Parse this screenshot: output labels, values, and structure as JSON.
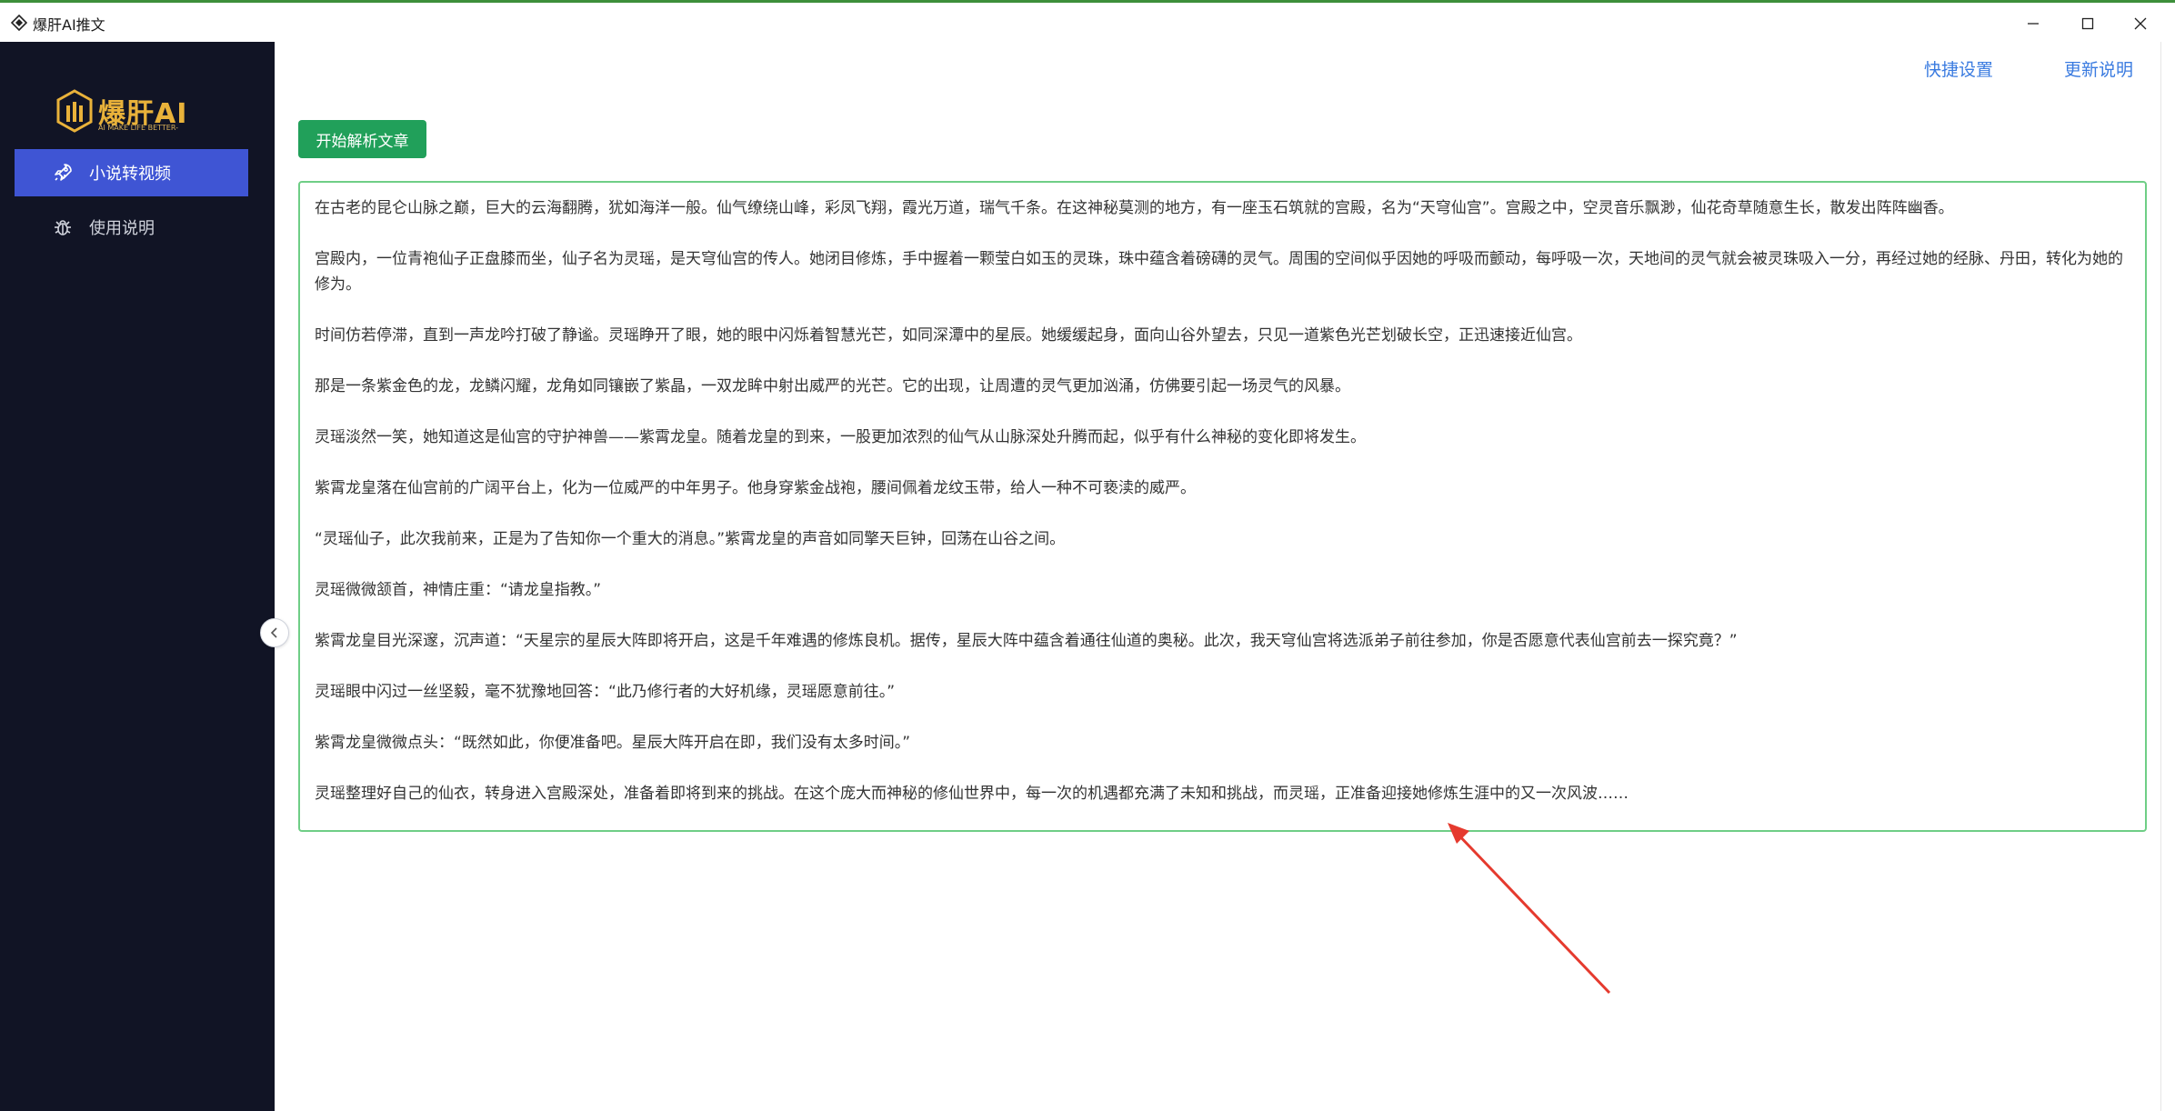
{
  "window": {
    "title": "爆肝AI推文",
    "controls": [
      "minimize-icon",
      "maximize-icon",
      "close-icon"
    ]
  },
  "sidebar": {
    "logo_text": "爆肝AI",
    "logo_subtitle": "AI MAKE LIFE BETTER-",
    "items": [
      {
        "label": "小说转视频",
        "icon": "rocket-icon",
        "active": true
      },
      {
        "label": "使用说明",
        "icon": "bug-icon",
        "active": false
      }
    ]
  },
  "header": {
    "shortcut_settings": "快捷设置",
    "update_notes": "更新说明"
  },
  "main": {
    "start_button": "开始解析文章",
    "paragraphs": [
      "在古老的昆仑山脉之巅，巨大的云海翻腾，犹如海洋一般。仙气缭绕山峰，彩凤飞翔，霞光万道，瑞气千条。在这神秘莫测的地方，有一座玉石筑就的宫殿，名为“天穹仙宫”。宫殿之中，空灵音乐飘渺，仙花奇草随意生长，散发出阵阵幽香。",
      "宫殿内，一位青袍仙子正盘膝而坐，仙子名为灵瑶，是天穹仙宫的传人。她闭目修炼，手中握着一颗莹白如玉的灵珠，珠中蕴含着磅礴的灵气。周围的空间似乎因她的呼吸而颤动，每呼吸一次，天地间的灵气就会被灵珠吸入一分，再经过她的经脉、丹田，转化为她的修为。",
      "时间仿若停滞，直到一声龙吟打破了静谧。灵瑶睁开了眼，她的眼中闪烁着智慧光芒，如同深潭中的星辰。她缓缓起身，面向山谷外望去，只见一道紫色光芒划破长空，正迅速接近仙宫。",
      "那是一条紫金色的龙，龙鳞闪耀，龙角如同镶嵌了紫晶，一双龙眸中射出威严的光芒。它的出现，让周遭的灵气更加汹涌，仿佛要引起一场灵气的风暴。",
      "灵瑶淡然一笑，她知道这是仙宫的守护神兽——紫霄龙皇。随着龙皇的到来，一股更加浓烈的仙气从山脉深处升腾而起，似乎有什么神秘的变化即将发生。",
      "紫霄龙皇落在仙宫前的广阔平台上，化为一位威严的中年男子。他身穿紫金战袍，腰间佩着龙纹玉带，给人一种不可亵渎的威严。",
      "“灵瑶仙子，此次我前来，正是为了告知你一个重大的消息。”紫霄龙皇的声音如同擎天巨钟，回荡在山谷之间。",
      "灵瑶微微颔首，神情庄重：“请龙皇指教。”",
      "紫霄龙皇目光深邃，沉声道：“天星宗的星辰大阵即将开启，这是千年难遇的修炼良机。据传，星辰大阵中蕴含着通往仙道的奥秘。此次，我天穹仙宫将选派弟子前往参加，你是否愿意代表仙宫前去一探究竟？”",
      "灵瑶眼中闪过一丝坚毅，毫不犹豫地回答：“此乃修行者的大好机缘，灵瑶愿意前往。”",
      "紫霄龙皇微微点头：“既然如此，你便准备吧。星辰大阵开启在即，我们没有太多时间。”",
      "灵瑶整理好自己的仙衣，转身进入宫殿深处，准备着即将到来的挑战。在这个庞大而神秘的修仙世界中，每一次的机遇都充满了未知和挑战，而灵瑶，正准备迎接她修炼生涯中的又一次风波……"
    ]
  },
  "annotation": {
    "arrow_color": "#e53a2e"
  },
  "colors": {
    "sidebar_bg": "#111425",
    "active_nav": "#3f55d4",
    "primary_button": "#21a05a",
    "textarea_border": "#6fce86",
    "link": "#3a7be0",
    "logo_gold": "#e9b23a"
  }
}
